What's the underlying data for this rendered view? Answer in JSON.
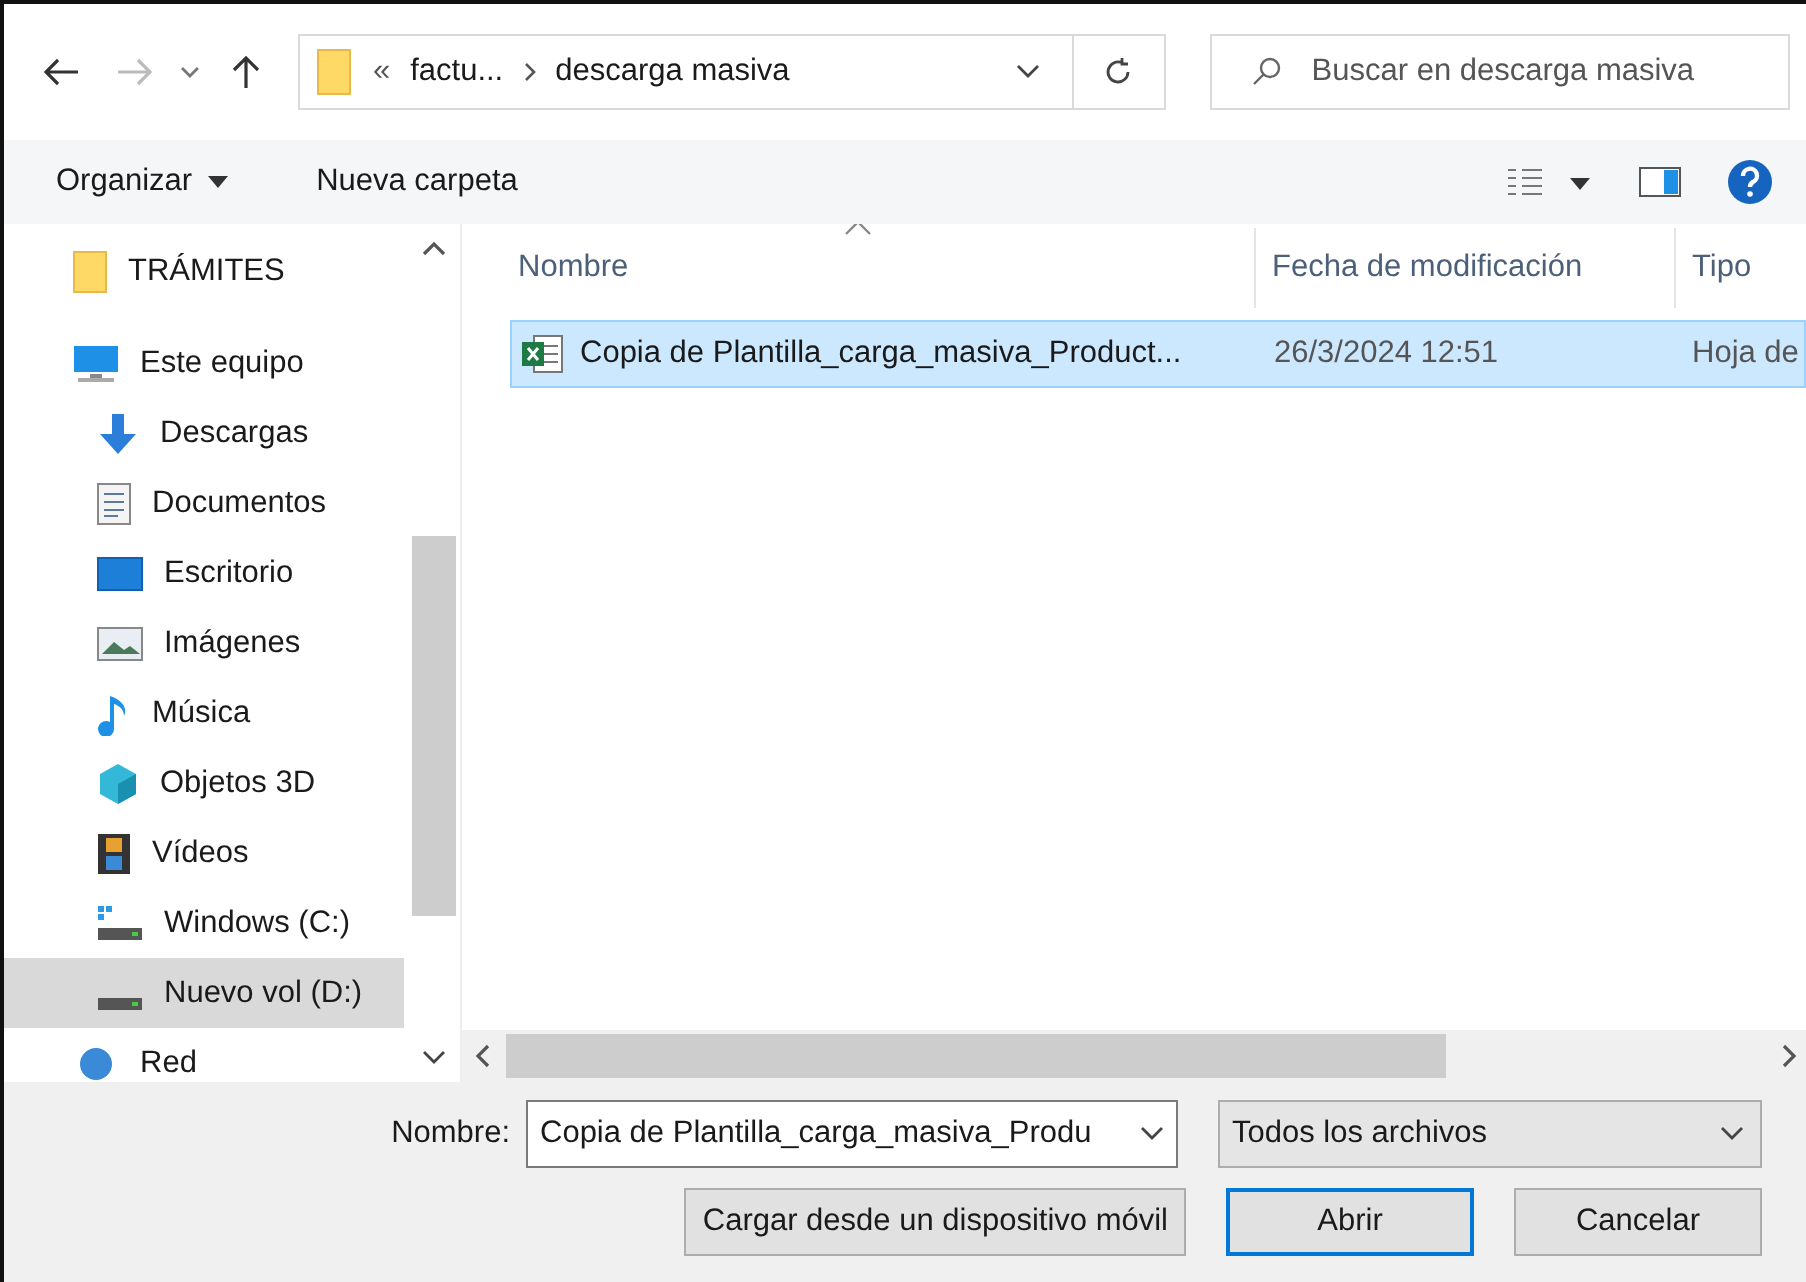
{
  "address_bar": {
    "overflow": "«",
    "crumbs": [
      "factu...",
      "descarga masiva"
    ]
  },
  "search": {
    "placeholder": "Buscar en descarga masiva"
  },
  "command_bar": {
    "organize": "Organizar",
    "new_folder": "Nueva carpeta"
  },
  "sidebar": {
    "items": [
      {
        "label": "TRÁMITES",
        "kind": "folder",
        "selected": false
      },
      {
        "label": "Este equipo",
        "kind": "pc",
        "selected": false,
        "children": [
          {
            "label": "Descargas",
            "kind": "downloads",
            "selected": false
          },
          {
            "label": "Documentos",
            "kind": "documents",
            "selected": false
          },
          {
            "label": "Escritorio",
            "kind": "desktop",
            "selected": false
          },
          {
            "label": "Imágenes",
            "kind": "pictures",
            "selected": false
          },
          {
            "label": "Música",
            "kind": "music",
            "selected": false
          },
          {
            "label": "Objetos 3D",
            "kind": "objects3d",
            "selected": false
          },
          {
            "label": "Vídeos",
            "kind": "videos",
            "selected": false
          },
          {
            "label": "Windows (C:)",
            "kind": "system-drive",
            "selected": false
          },
          {
            "label": "Nuevo vol (D:)",
            "kind": "drive",
            "selected": true
          }
        ]
      },
      {
        "label": "Red",
        "kind": "network",
        "selected": false
      }
    ]
  },
  "file_list": {
    "columns": [
      {
        "label": "Nombre",
        "sorted": true
      },
      {
        "label": "Fecha de modificación",
        "sorted": false
      },
      {
        "label": "Tipo",
        "sorted": false
      }
    ],
    "rows": [
      {
        "name": "Copia de Plantilla_carga_masiva_Product...",
        "modified": "26/3/2024 12:51",
        "type": "Hoja de",
        "selected": true
      }
    ]
  },
  "footer": {
    "name_label": "Nombre:",
    "name_value": "Copia de Plantilla_carga_masiva_Produ",
    "filter": "Todos los archivos",
    "buttons": [
      {
        "label": "Cargar desde un dispositivo móvil",
        "focused": false
      },
      {
        "label": "Abrir",
        "focused": true
      },
      {
        "label": "Cancelar",
        "focused": false
      }
    ]
  }
}
